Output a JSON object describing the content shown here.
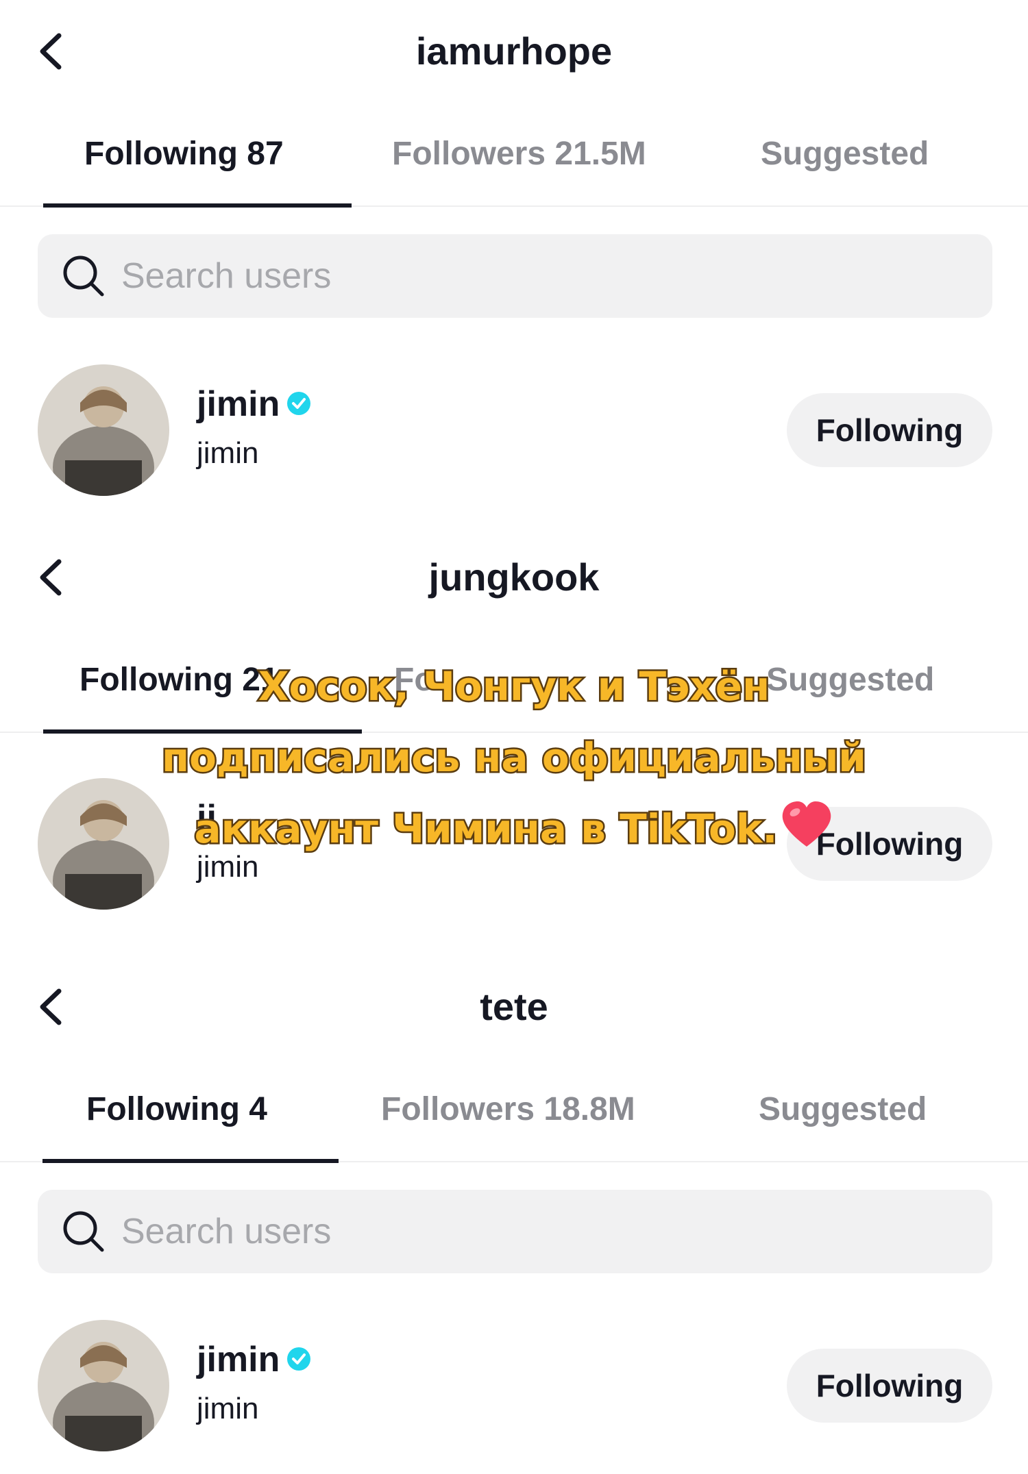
{
  "panels": [
    {
      "title": "iamurhope",
      "tabs": {
        "following": "Following 87",
        "followers": "Followers 21.5M",
        "suggested": "Suggested"
      },
      "search_placeholder": "Search users",
      "user": {
        "username": "jimin",
        "nickname": "jimin",
        "button": "Following"
      }
    },
    {
      "title": "jungkook",
      "tabs": {
        "following": "Following 21",
        "followers": "Fo",
        "suggested": "Suggested"
      },
      "user": {
        "username": "ji",
        "nickname": "jimin",
        "button": "Following"
      }
    },
    {
      "title": "tete",
      "tabs": {
        "following": "Following 4",
        "followers": "Followers 18.8M",
        "suggested": "Suggested"
      },
      "search_placeholder": "Search users",
      "user": {
        "username": "jimin",
        "nickname": "jimin",
        "button": "Following"
      }
    }
  ],
  "overlay_caption": {
    "line1": "Хосок, Чонгук и Тэхён",
    "line2": "подписались на официальный",
    "line3": "аккаунт Чимина в TikTok.",
    "emoji": "heart-icon"
  },
  "colors": {
    "verified": "#20d5ec",
    "caption_fill": "#f7b728",
    "caption_stroke": "#5a3c10",
    "heart": "#f5405f"
  }
}
